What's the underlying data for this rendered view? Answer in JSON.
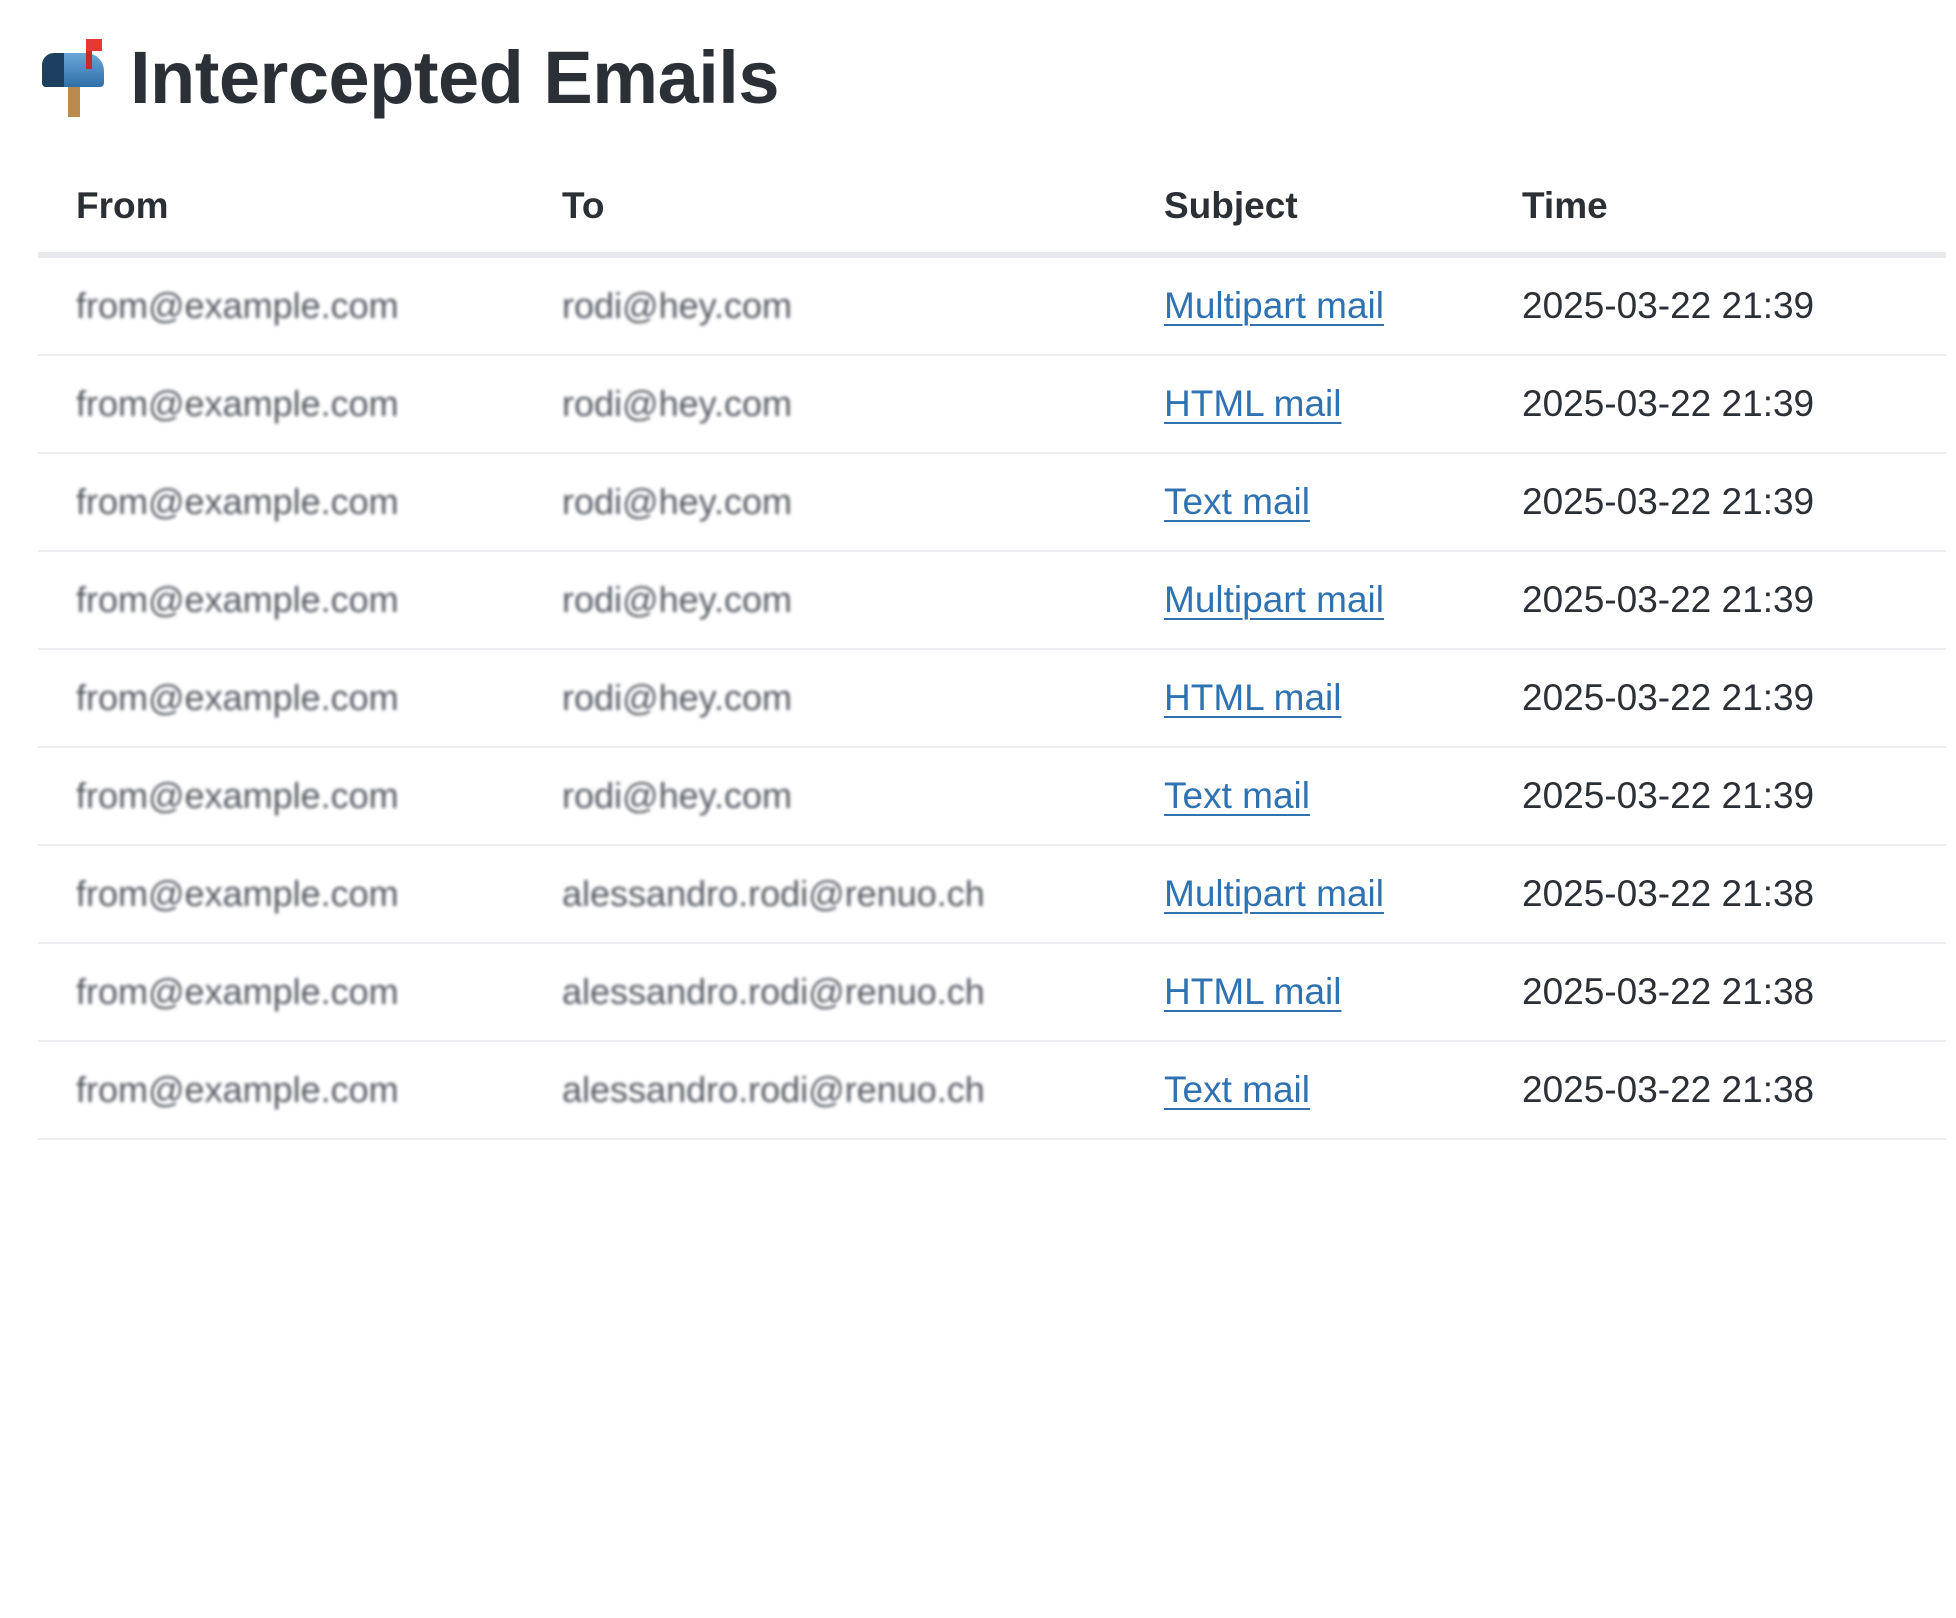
{
  "page": {
    "title": "Intercepted Emails",
    "title_icon": "mailbox-icon"
  },
  "table": {
    "headers": {
      "from": "From",
      "to": "To",
      "subject": "Subject",
      "time": "Time"
    },
    "rows": [
      {
        "from": "from@example.com",
        "to": "rodi@hey.com",
        "subject": "Multipart mail",
        "time": "2025-03-22 21:39"
      },
      {
        "from": "from@example.com",
        "to": "rodi@hey.com",
        "subject": "HTML mail",
        "time": "2025-03-22 21:39"
      },
      {
        "from": "from@example.com",
        "to": "rodi@hey.com",
        "subject": "Text mail",
        "time": "2025-03-22 21:39"
      },
      {
        "from": "from@example.com",
        "to": "rodi@hey.com",
        "subject": "Multipart mail",
        "time": "2025-03-22 21:39"
      },
      {
        "from": "from@example.com",
        "to": "rodi@hey.com",
        "subject": "HTML mail",
        "time": "2025-03-22 21:39"
      },
      {
        "from": "from@example.com",
        "to": "rodi@hey.com",
        "subject": "Text mail",
        "time": "2025-03-22 21:39"
      },
      {
        "from": "from@example.com",
        "to": "alessandro.rodi@renuo.ch",
        "subject": "Multipart mail",
        "time": "2025-03-22 21:38"
      },
      {
        "from": "from@example.com",
        "to": "alessandro.rodi@renuo.ch",
        "subject": "HTML mail",
        "time": "2025-03-22 21:38"
      },
      {
        "from": "from@example.com",
        "to": "alessandro.rodi@renuo.ch",
        "subject": "Text mail",
        "time": "2025-03-22 21:38"
      }
    ]
  },
  "colors": {
    "text": "#2b2f36",
    "link": "#2f72b1",
    "divider": "#eceef1"
  }
}
